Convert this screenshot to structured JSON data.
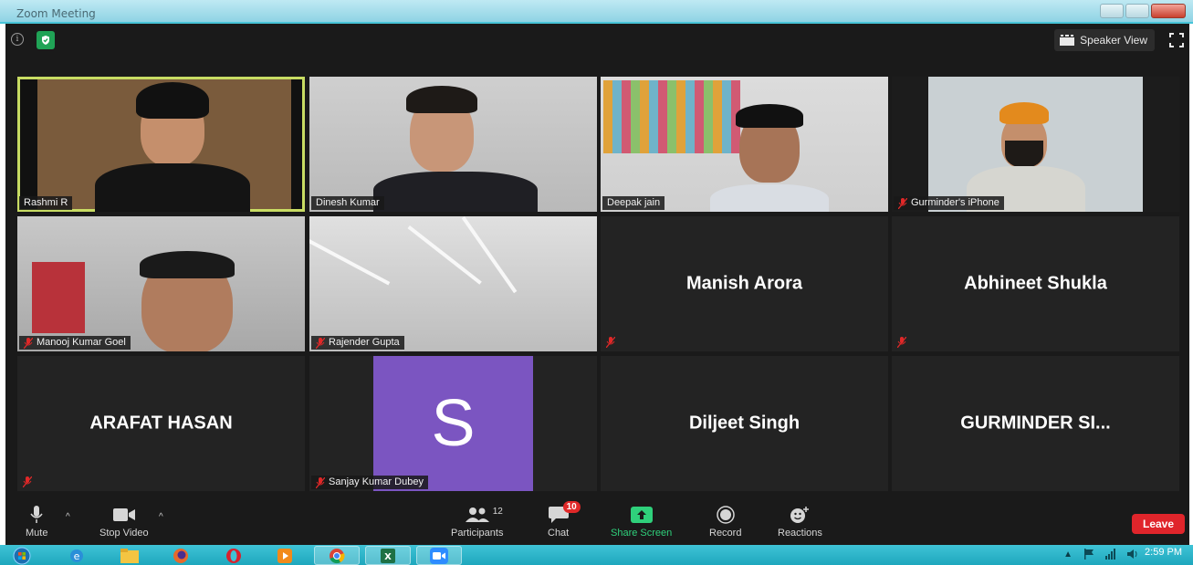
{
  "window": {
    "title": "Zoom Meeting"
  },
  "topbar": {
    "speaker_view_label": "Speaker View",
    "icons": [
      "info-icon",
      "shield-check-icon",
      "grid-icon",
      "fullscreen-icon"
    ]
  },
  "tiles": [
    {
      "name": "Rashmi R",
      "video": true,
      "active": true,
      "muted": false
    },
    {
      "name": "Dinesh Kumar",
      "video": true,
      "active": false,
      "muted": false
    },
    {
      "name": "Deepak jain",
      "video": true,
      "active": false,
      "muted": false
    },
    {
      "name": "Gurminder's iPhone",
      "video": true,
      "active": false,
      "muted": true
    },
    {
      "name": "Manooj Kumar Goel",
      "video": true,
      "active": false,
      "muted": true
    },
    {
      "name": "Rajender Gupta",
      "video": true,
      "active": false,
      "muted": true
    },
    {
      "name": "Manish Arora",
      "video": false,
      "active": false,
      "muted": true
    },
    {
      "name": "Abhineet Shukla",
      "video": false,
      "active": false,
      "muted": true
    },
    {
      "name": "ARAFAT HASAN",
      "video": false,
      "active": false,
      "muted": true
    },
    {
      "name": "Sanjay Kumar Dubey",
      "video": false,
      "avatar_letter": "S",
      "avatar_color": "#7b55c1",
      "active": false,
      "muted": true
    },
    {
      "name": "Diljeet Singh",
      "video": false,
      "active": false,
      "muted": false
    },
    {
      "name": "GURMINDER SI...",
      "video": false,
      "active": false,
      "muted": false
    }
  ],
  "toolbar": {
    "mute_label": "Mute",
    "stop_video_label": "Stop Video",
    "participants_label": "Participants",
    "participants_count": "12",
    "chat_label": "Chat",
    "chat_badge": "10",
    "share_screen_label": "Share Screen",
    "record_label": "Record",
    "reactions_label": "Reactions",
    "leave_label": "Leave"
  },
  "colors": {
    "active_speaker_border": "#c8dc63",
    "share_green": "#2fd07b",
    "leave_red": "#e0252b",
    "badge_red": "#e02828",
    "secure_green": "#20a356"
  },
  "taskbar": {
    "apps": [
      "windows-start-icon",
      "internet-explorer-icon",
      "file-explorer-icon",
      "firefox-icon",
      "opera-icon",
      "media-player-icon",
      "chrome-icon",
      "excel-icon",
      "zoom-icon"
    ],
    "clock_time": "2:59 PM"
  }
}
